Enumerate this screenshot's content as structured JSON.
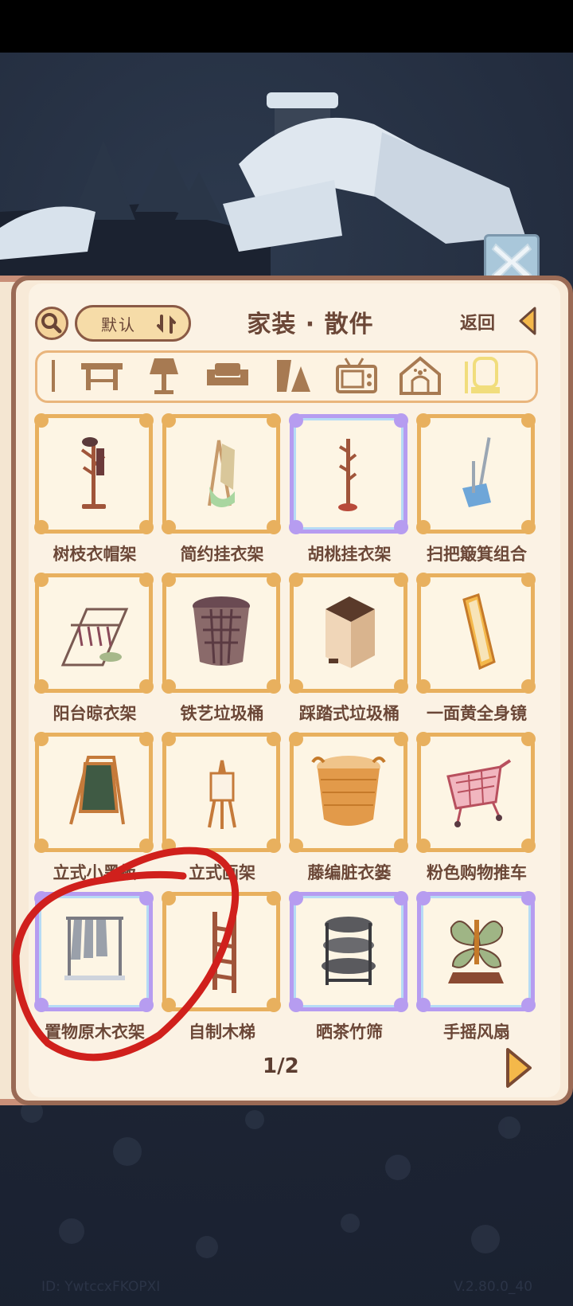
{
  "header": {
    "title": "家装 · 散件",
    "sort_label": "默认",
    "back_label": "返回"
  },
  "categories": [
    "stick-icon",
    "table-icon",
    "lamp-icon",
    "sofa-icon",
    "shapes-icon",
    "tv-icon",
    "pet-house-icon",
    "coat-rack-icon"
  ],
  "items": [
    {
      "label": "树枝衣帽架",
      "rarity": "gold"
    },
    {
      "label": "简约挂衣架",
      "rarity": "gold"
    },
    {
      "label": "胡桃挂衣架",
      "rarity": "purple"
    },
    {
      "label": "扫把簸箕组合",
      "rarity": "gold"
    },
    {
      "label": "阳台晾衣架",
      "rarity": "gold"
    },
    {
      "label": "铁艺垃圾桶",
      "rarity": "gold"
    },
    {
      "label": "踩踏式垃圾桶",
      "rarity": "gold"
    },
    {
      "label": "一面黄全身镜",
      "rarity": "gold"
    },
    {
      "label": "立式小黑板",
      "rarity": "gold"
    },
    {
      "label": "立式画架",
      "rarity": "gold"
    },
    {
      "label": "藤编脏衣篓",
      "rarity": "gold"
    },
    {
      "label": "粉色购物推车",
      "rarity": "gold"
    },
    {
      "label": "置物原木衣架",
      "rarity": "purple"
    },
    {
      "label": "自制木梯",
      "rarity": "gold"
    },
    {
      "label": "晒茶竹筛",
      "rarity": "purple"
    },
    {
      "label": "手摇风扇",
      "rarity": "purple"
    }
  ],
  "pagination": {
    "current": "1/2"
  },
  "footer": {
    "id_text": "ID: YwtccxFKOPXI",
    "version": "V.2.80.0_40"
  }
}
